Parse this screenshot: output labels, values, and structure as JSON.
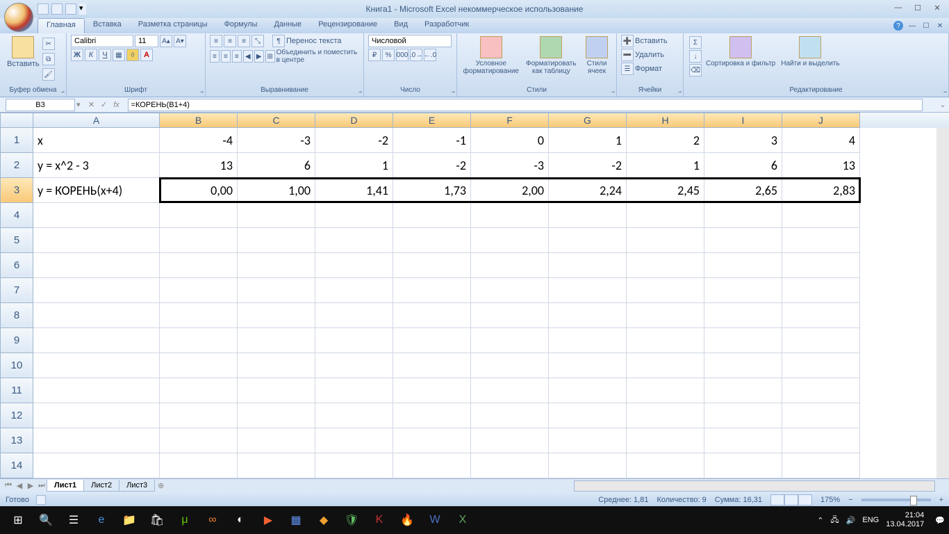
{
  "title": "Книга1 - Microsoft Excel некоммерческое использование",
  "tabs": [
    "Главная",
    "Вставка",
    "Разметка страницы",
    "Формулы",
    "Данные",
    "Рецензирование",
    "Вид",
    "Разработчик"
  ],
  "ribbon": {
    "clipboard": {
      "paste": "Вставить",
      "label": "Буфер обмена"
    },
    "font": {
      "name": "Calibri",
      "size": "11",
      "label": "Шрифт"
    },
    "alignment": {
      "wrap": "Перенос текста",
      "merge": "Объединить и поместить в центре",
      "label": "Выравнивание"
    },
    "number": {
      "format": "Числовой",
      "label": "Число"
    },
    "styles": {
      "cond": "Условное форматирование",
      "tbl": "Форматировать как таблицу",
      "cell": "Стили ячеек",
      "label": "Стили"
    },
    "cells": {
      "insert": "Вставить",
      "delete": "Удалить",
      "format": "Формат",
      "label": "Ячейки"
    },
    "editing": {
      "sort": "Сортировка и фильтр",
      "find": "Найти и выделить",
      "label": "Редактирование"
    }
  },
  "namebox": "B3",
  "formula": "=КОРЕНЬ(B1+4)",
  "columns": [
    "A",
    "B",
    "C",
    "D",
    "E",
    "F",
    "G",
    "H",
    "I",
    "J"
  ],
  "rownums": [
    "1",
    "2",
    "3",
    "4",
    "5",
    "6",
    "7",
    "8",
    "9",
    "10",
    "11",
    "12",
    "13",
    "14"
  ],
  "cells": {
    "r1": {
      "a": "x",
      "b": "-4",
      "c": "-3",
      "d": "-2",
      "e": "-1",
      "f": "0",
      "g": "1",
      "h": "2",
      "i": "3",
      "j": "4"
    },
    "r2": {
      "a": "y = x^2 - 3",
      "b": "13",
      "c": "6",
      "d": "1",
      "e": "-2",
      "f": "-3",
      "g": "-2",
      "h": "1",
      "i": "6",
      "j": "13"
    },
    "r3": {
      "a": "y = КОРЕНЬ(x+4)",
      "b": "0,00",
      "c": "1,00",
      "d": "1,41",
      "e": "1,73",
      "f": "2,00",
      "g": "2,24",
      "h": "2,45",
      "i": "2,65",
      "j": "2,83"
    }
  },
  "sheets": [
    "Лист1",
    "Лист2",
    "Лист3"
  ],
  "status": {
    "ready": "Готово",
    "avg": "Среднее: 1,81",
    "count": "Количество: 9",
    "sum": "Сумма: 16,31",
    "zoom": "175%"
  },
  "tray": {
    "lang": "ENG",
    "time": "21:04",
    "date": "13.04.2017"
  }
}
